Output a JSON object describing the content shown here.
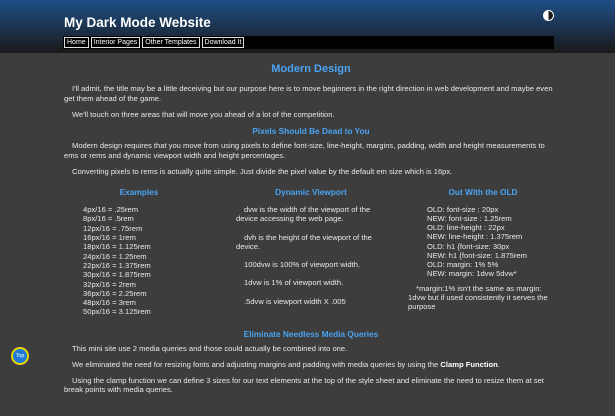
{
  "header": {
    "title": "My Dark Mode Website",
    "nav": [
      "Home",
      "Interior Pages",
      "Other Templates",
      "Download It"
    ]
  },
  "main": {
    "heading": "Modern Design",
    "intro": [
      "I'll admit, the title may be a little deceiving but our purpose here is to move beginners in the right direction in web development and maybe even get them ahead of the game.",
      "We'll touch on three areas that will move you ahead of a lot of the competition."
    ],
    "section1": {
      "heading": "Pixels Should Be Dead to You",
      "paragraphs": [
        "Modern design requires that you move from using pixels to define font-size, line-height, margins, padding, width and height measurements to ems or rems and dynamic viewport width and height percentages.",
        "Converting pixels to rems is actually quite simple. Just divide the pixel value by the default em size which is 16px."
      ]
    },
    "columns": {
      "examples": {
        "heading": "Examples",
        "items": [
          "4px/16  = .25rem",
          "8px/16  = .5rem",
          "12px/16 = .75rem",
          "16px/16 = 1rem",
          "18px/16 = 1.125rem",
          "24px/16 = 1.25rem",
          "22px/16 = 1.375rem",
          "30px/16 = 1.875rem",
          "32px/16 = 2rem",
          "36px/16 = 2.25rem",
          "48px/16 = 3rem",
          "50px/16 = 3.125rem"
        ]
      },
      "viewport": {
        "heading": "Dynamic Viewport",
        "paragraphs": [
          "dvw is the width of the viewport of the device accessing the web page.",
          "dvh is the height of the viewport of the device.",
          "100dvw is 100% of viewport width.",
          "1dvw is 1% of viewport width.",
          ".5dvw is viewport width X .005"
        ]
      },
      "old": {
        "heading": "Out With the OLD",
        "items": [
          "OLD: font-size : 20px",
          "NEW: font-size : 1.25rem",
          "OLD: line-height : 22px",
          "NEW: line-height : 1.375rem",
          "OLD: h1 {font-size: 30px",
          "NEW: h1 {font-size: 1.875rem",
          "OLD: margin: 1% 5%",
          "NEW: margin: 1dvw 5dvw*"
        ],
        "note": "*margin:1% isn't the same as margin: 1dvw but if used consistently it serves the purpose"
      }
    },
    "section2": {
      "heading": "Eliminate Needless Media Queries",
      "p1": "This mini site use 2 media queries and those could actually be combined into one.",
      "p2_text": "We eliminated the need for resizing fonts and adjusting margins and padding with media queries by using the ",
      "p2_bold": "Clamp Function",
      "p2_end": ".",
      "p3": "Using the clamp function we can define 3 sizes for our text elements at the top of the style sheet and eliminate the need to resize them at set break points with media queries."
    }
  },
  "top_button": {
    "label": "Top"
  },
  "colors": {
    "accent": "#4aa3f0",
    "background": "#3d3d3d",
    "header_top": "#1f4f86",
    "top_button_border": "#e6d20a"
  },
  "icons": {
    "theme_toggle": "half-circle-contrast-icon"
  }
}
